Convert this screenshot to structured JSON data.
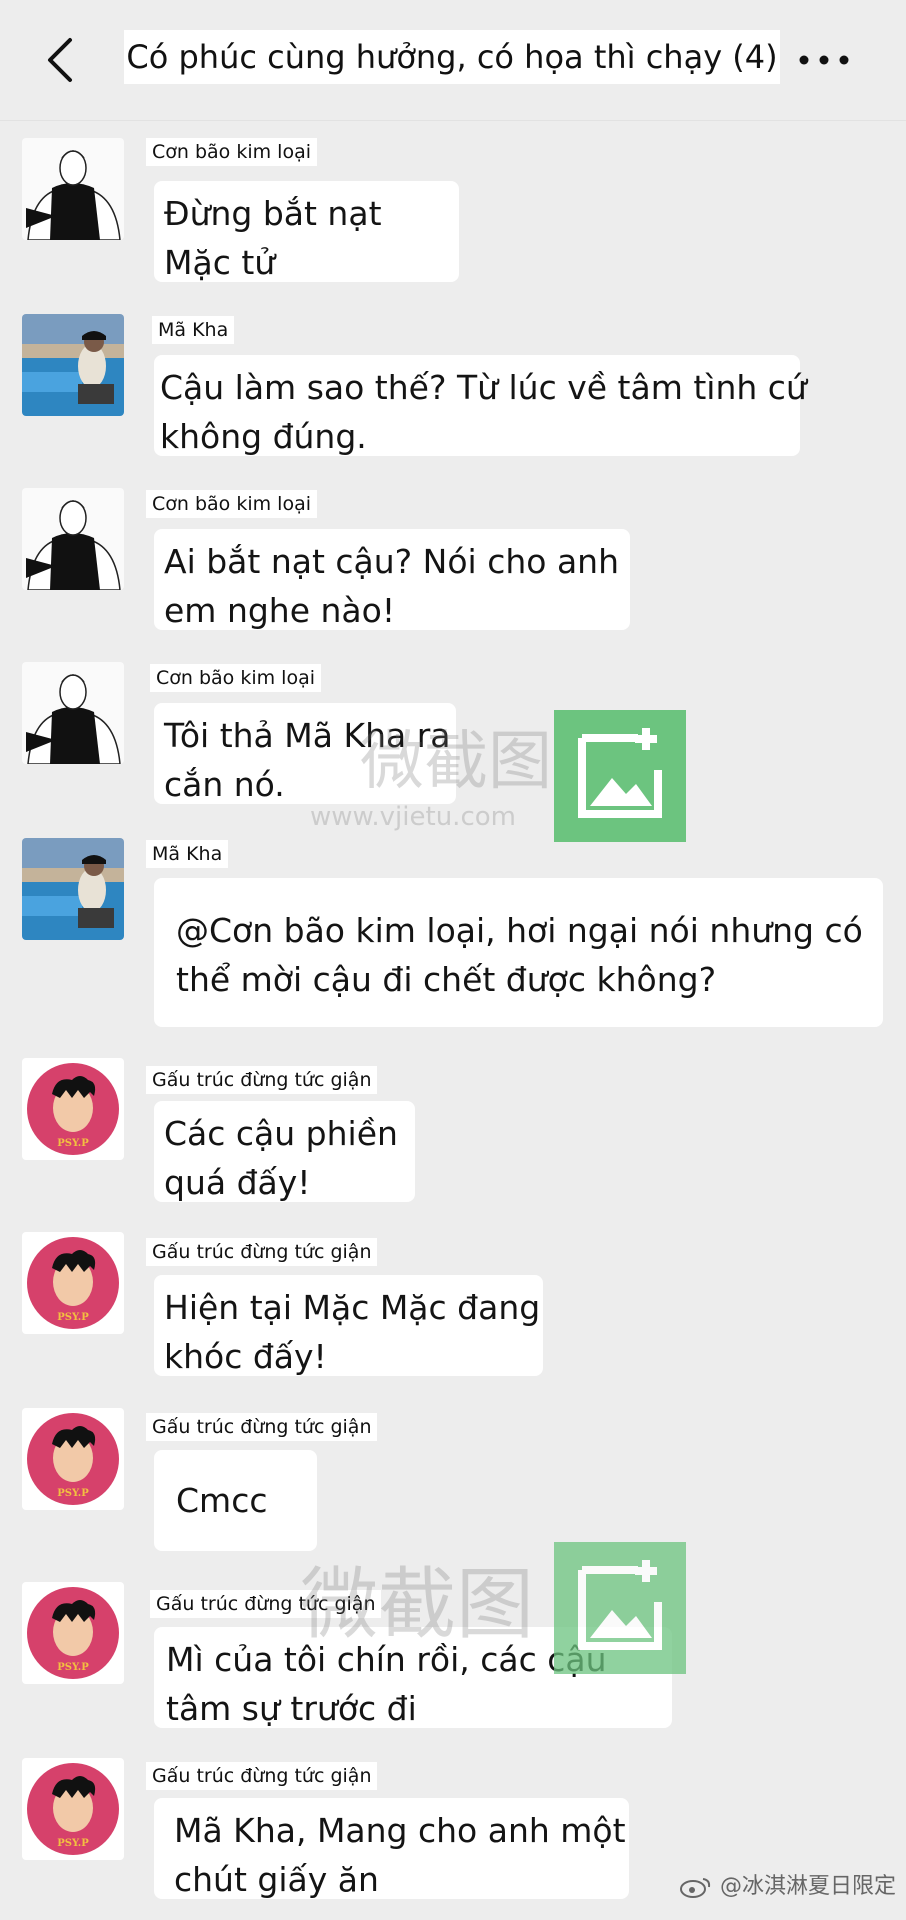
{
  "header": {
    "title": "Có phúc cùng hưởng, có họa thì chạy (4)"
  },
  "messages": [
    {
      "name": "Cơn bão kim loại",
      "avatar": "sketch-avatar",
      "lines": [
        "Đừng bắt nạt",
        "Mặc tử"
      ]
    },
    {
      "name": "Mã Kha",
      "avatar": "pool-photo-avatar",
      "lines": [
        "Cậu làm sao thế? Từ lúc về tâm tình cứ",
        "không đúng."
      ]
    },
    {
      "name": "Cơn bão kim loại",
      "avatar": "sketch-avatar",
      "lines": [
        "Ai bắt nạt cậu? Nói cho anh",
        "em nghe nào!"
      ]
    },
    {
      "name": "Cơn bão kim loại",
      "avatar": "sketch-avatar",
      "lines": [
        "Tôi thả Mã Kha ra",
        "cắn nó."
      ]
    },
    {
      "name": "Mã Kha",
      "avatar": "pool-photo-avatar",
      "lines": [
        "@Cơn bão kim loại, hơi ngại nói nhưng có",
        "thể mời cậu đi chết được không?"
      ]
    },
    {
      "name": "Gấu trúc đừng tức giận",
      "avatar": "pink-badge-avatar",
      "lines": [
        "Các cậu phiền",
        "quá đấy!"
      ]
    },
    {
      "name": "Gấu trúc đừng tức giận",
      "avatar": "pink-badge-avatar",
      "lines": [
        "Hiện tại Mặc Mặc đang",
        "khóc đấy!"
      ]
    },
    {
      "name": "Gấu trúc đừng tức giận",
      "avatar": "pink-badge-avatar",
      "lines": [
        "Cmcc"
      ]
    },
    {
      "name": "Gấu trúc đừng tức giận",
      "avatar": "pink-badge-avatar",
      "lines": [
        "Mì của tôi chín rồi, các cậu",
        "tâm sự trước đi"
      ]
    },
    {
      "name": "Gấu trúc đừng tức giận",
      "avatar": "pink-badge-avatar",
      "lines": [
        "Mã Kha, Mang cho anh một",
        "chút giấy ăn"
      ]
    }
  ],
  "badge_text": "PSY.P",
  "watermark": {
    "cn": "微截图",
    "url": "www.vjietu.com",
    "corner": "@冰淇淋夏日限定"
  },
  "colors": {
    "background": "#ededed",
    "bubble": "#ffffff",
    "watermark_green": "#6cc47f",
    "badge_pink": "#d6416b"
  }
}
